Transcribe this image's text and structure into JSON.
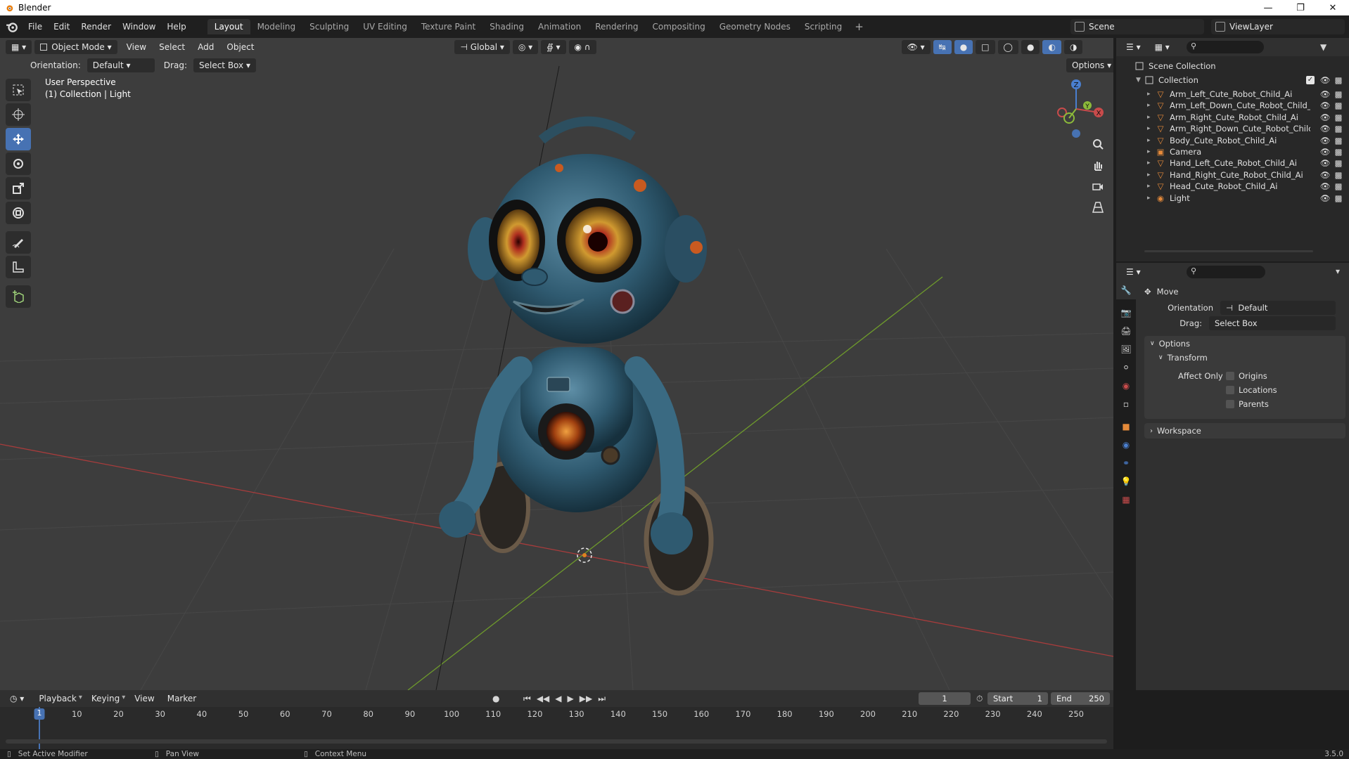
{
  "window": {
    "title": "Blender"
  },
  "menus": [
    "File",
    "Edit",
    "Render",
    "Window",
    "Help"
  ],
  "workspaces": [
    "Layout",
    "Modeling",
    "Sculpting",
    "UV Editing",
    "Texture Paint",
    "Shading",
    "Animation",
    "Rendering",
    "Compositing",
    "Geometry Nodes",
    "Scripting"
  ],
  "active_workspace": "Layout",
  "scene": "Scene",
  "view_layer": "ViewLayer",
  "viewport": {
    "mode": "Object Mode",
    "menus": [
      "View",
      "Select",
      "Add",
      "Object"
    ],
    "transform_orientation": "Global",
    "orientation_label": "Orientation:",
    "orientation_value": "Default",
    "drag_label": "Drag:",
    "drag_value": "Select Box",
    "options_label": "Options",
    "perspective_label": "User Perspective",
    "collection_label": "(1) Collection | Light"
  },
  "outliner": {
    "root": "Scene Collection",
    "collection": "Collection",
    "items": [
      {
        "name": "Arm_Left_Cute_Robot_Child_Ai",
        "type": "mesh"
      },
      {
        "name": "Arm_Left_Down_Cute_Robot_Child_",
        "type": "mesh"
      },
      {
        "name": "Arm_Right_Cute_Robot_Child_Ai",
        "type": "mesh"
      },
      {
        "name": "Arm_Right_Down_Cute_Robot_Chilc",
        "type": "mesh"
      },
      {
        "name": "Body_Cute_Robot_Child_Ai",
        "type": "mesh"
      },
      {
        "name": "Camera",
        "type": "camera"
      },
      {
        "name": "Hand_Left_Cute_Robot_Child_Ai",
        "type": "mesh"
      },
      {
        "name": "Hand_Right_Cute_Robot_Child_Ai",
        "type": "mesh"
      },
      {
        "name": "Head_Cute_Robot_Child_Ai",
        "type": "mesh"
      },
      {
        "name": "Light",
        "type": "light"
      }
    ]
  },
  "properties": {
    "tool_name": "Move",
    "orientation_label": "Orientation",
    "orientation_value": "Default",
    "drag_label": "Drag:",
    "drag_value": "Select Box",
    "options_panel": "Options",
    "transform_subpanel": "Transform",
    "affect_only_label": "Affect Only",
    "affect_options": [
      "Origins",
      "Locations",
      "Parents"
    ],
    "workspace_panel": "Workspace"
  },
  "timeline": {
    "menus": [
      "Playback",
      "Keying",
      "View",
      "Marker"
    ],
    "current_frame": "1",
    "start_label": "Start",
    "start_value": "1",
    "end_label": "End",
    "end_value": "250",
    "ruler_marks": [
      "1",
      "10",
      "20",
      "30",
      "40",
      "50",
      "60",
      "70",
      "80",
      "90",
      "100",
      "110",
      "120",
      "130",
      "140",
      "150",
      "160",
      "170",
      "180",
      "190",
      "200",
      "210",
      "220",
      "230",
      "240",
      "250"
    ]
  },
  "statusbar": {
    "left": "Set Active Modifier",
    "middle": "Pan View",
    "right_hint": "Context Menu",
    "version": "3.5.0"
  },
  "colors": {
    "accent": "#4772b3",
    "x_axis": "#c84b4b",
    "y_axis": "#8cba3a",
    "z_axis": "#4a7fcf",
    "mesh_icon": "#e58a3a",
    "light_icon": "#86c27a"
  }
}
